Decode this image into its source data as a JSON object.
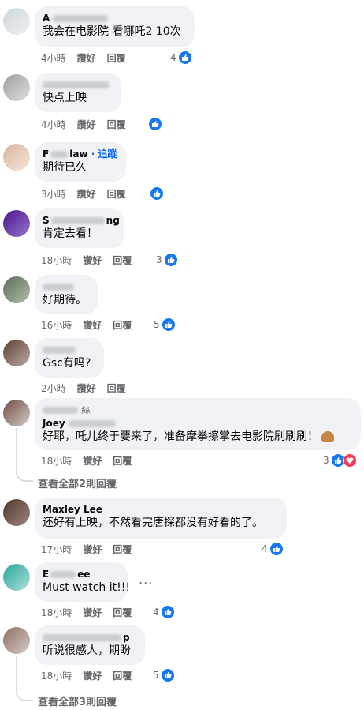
{
  "comments": [
    {
      "name": "A",
      "text": "我会在电影院 看哪吒2 10次",
      "time": "4小時",
      "like": "讚好",
      "reply": "回覆",
      "reactions": "4"
    },
    {
      "name": "",
      "text": "快点上映",
      "time": "4小時",
      "like": "讚好",
      "reply": "回覆",
      "reactions": ""
    },
    {
      "name": "F",
      "name_suffix": "law",
      "follow": "· 追蹤",
      "text": "期待已久",
      "time": "3小時",
      "like": "讚好",
      "reply": "回覆",
      "reactions": ""
    },
    {
      "name": "S",
      "name_suffix": "ng",
      "text": "肯定去看！",
      "time": "18小時",
      "like": "讚好",
      "reply": "回覆",
      "reactions": "3"
    },
    {
      "name": "",
      "text": "好期待。",
      "time": "16小時",
      "like": "讚好",
      "reply": "回覆",
      "reactions": "5"
    },
    {
      "name": "",
      "text": "Gsc有吗?",
      "time": "2小時",
      "like": "讚好",
      "reply": "回覆",
      "reactions": ""
    },
    {
      "name": "",
      "name_suffix": "絲",
      "subname": "Joey",
      "text": "好耶，吒儿终于要来了，准备摩拳擦掌去电影院刷刷刷！",
      "time": "18小時",
      "like": "讚好",
      "reply": "回覆",
      "reactions": "3",
      "view_replies": "查看全部2則回覆"
    },
    {
      "name": "Maxley Lee",
      "text": "还好有上映，不然看完唐探都没有好看的了。",
      "time": "17小時",
      "like": "讚好",
      "reply": "回覆",
      "reactions": "4"
    },
    {
      "name": "E",
      "name_suffix": "ee",
      "text": "Must watch it!!!",
      "time": "18小時",
      "like": "讚好",
      "reply": "回覆",
      "reactions": "4",
      "more": "..."
    },
    {
      "name": "",
      "name_suffix": "p",
      "text": "听说很感人，期盼",
      "time": "18小時",
      "like": "讚好",
      "reply": "回覆",
      "reactions": "5",
      "view_replies": "查看全部3則回覆"
    }
  ],
  "colors": {
    "like": "#1877f2",
    "love": "#f33e58",
    "bubble": "#f0f2f5",
    "meta": "#65676b",
    "follow": "#0866ff"
  },
  "icons": {
    "like": "thumbs-up-icon",
    "love": "heart-icon",
    "more": "more-options-icon"
  }
}
